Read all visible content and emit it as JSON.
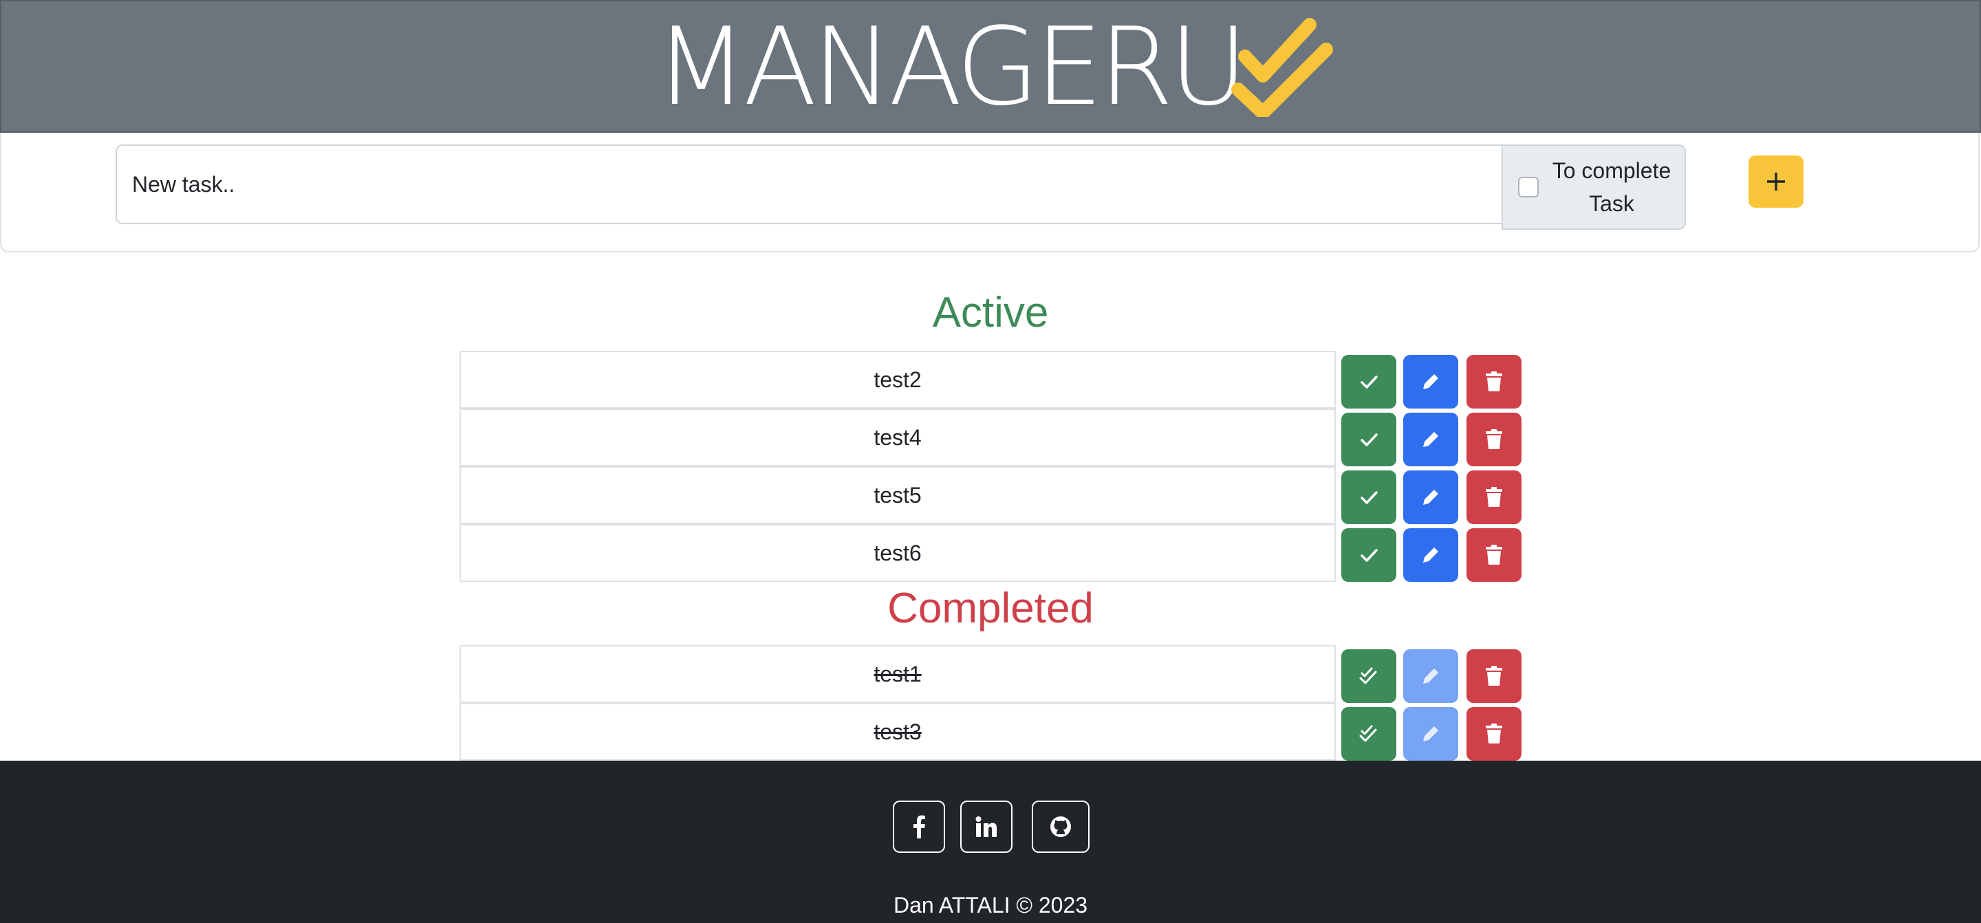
{
  "header": {
    "brand": "MANAGERU",
    "accent_color": "#f8c53a"
  },
  "form": {
    "task_placeholder": "New task..",
    "complete_label": "To complete Task",
    "add_button_label": "+"
  },
  "active": {
    "title": "Active",
    "color": "#3d8b59",
    "tasks": [
      {
        "label": "test2"
      },
      {
        "label": "test4"
      },
      {
        "label": "test5"
      },
      {
        "label": "test6"
      }
    ]
  },
  "completed": {
    "title": "Completed",
    "color": "#cf4049",
    "tasks": [
      {
        "label": "test1"
      },
      {
        "label": "test3"
      }
    ]
  },
  "footer": {
    "social": [
      "facebook-icon",
      "linkedin-icon",
      "github-icon"
    ],
    "copyright": "Dan ATTALI © 2023"
  }
}
